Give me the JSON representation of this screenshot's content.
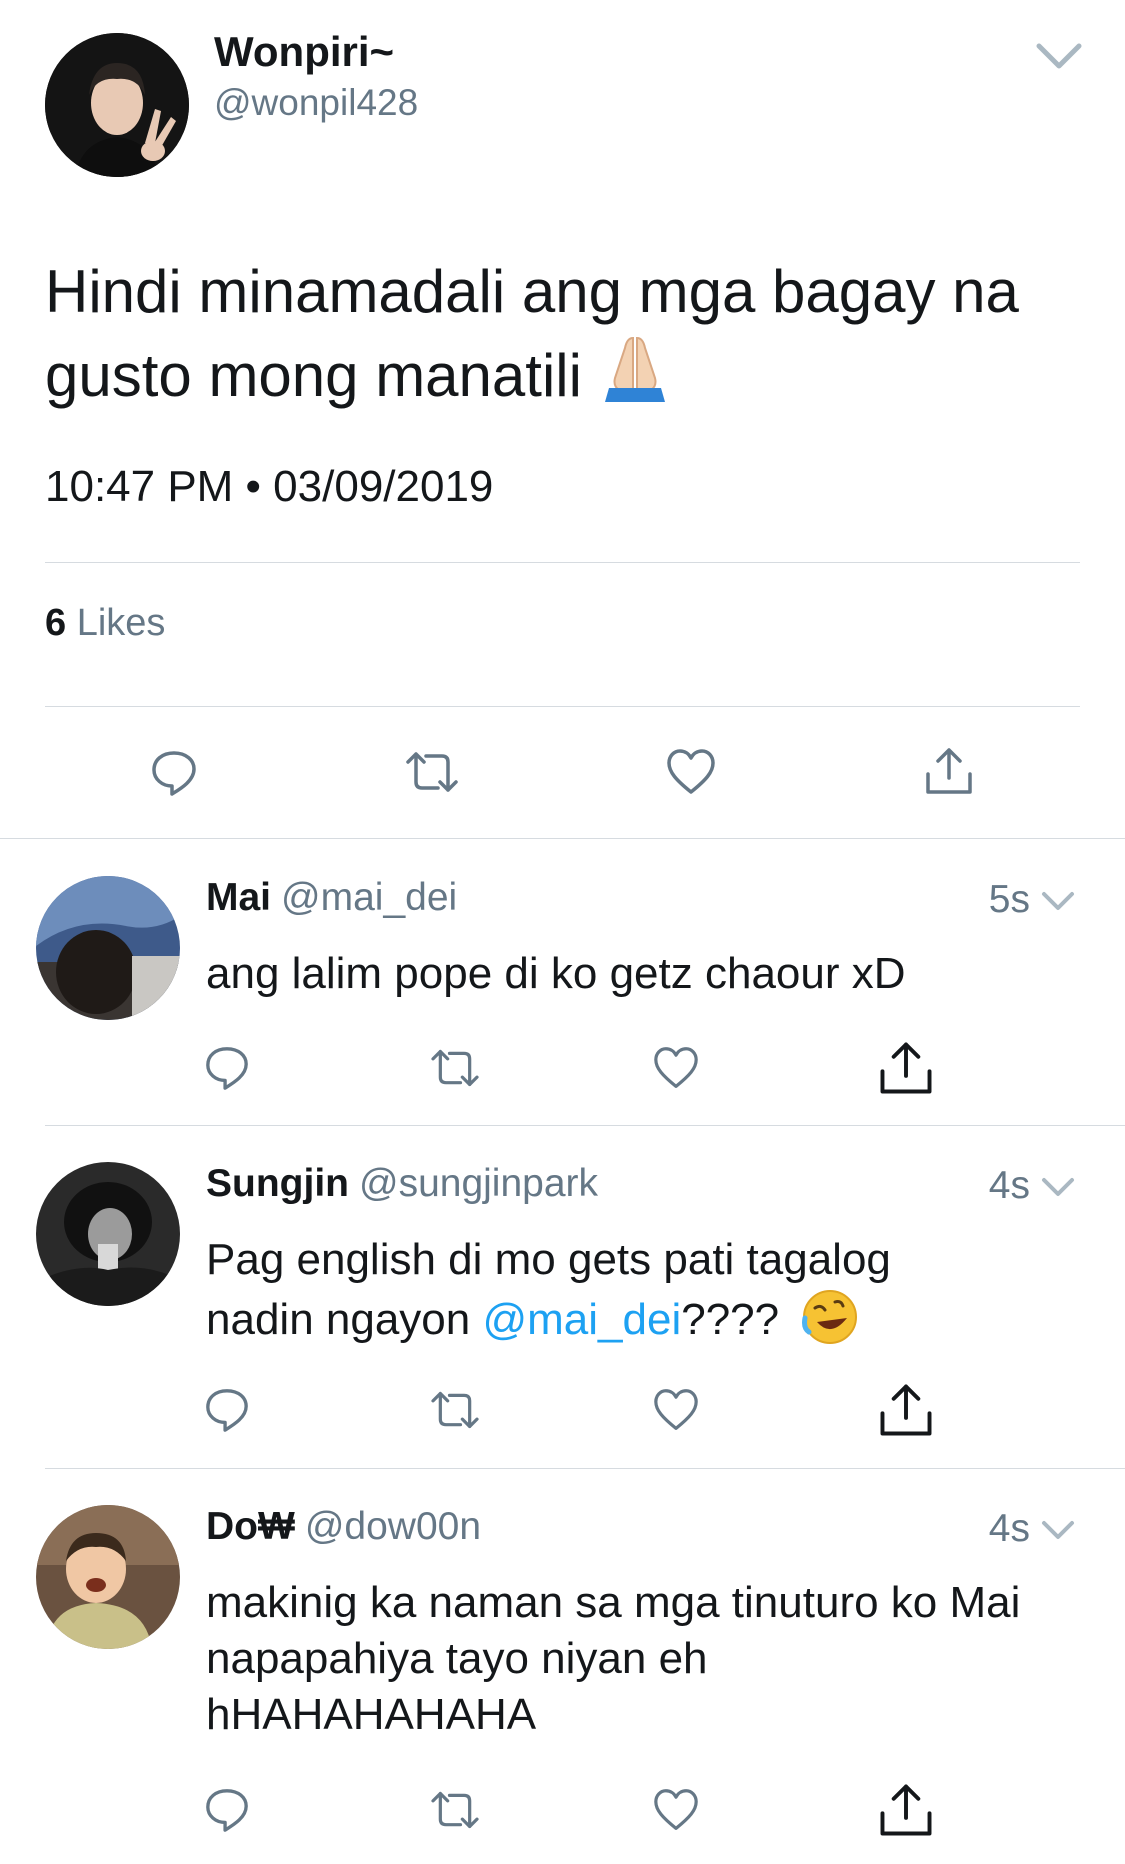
{
  "main_tweet": {
    "display_name": "Wonpiri~",
    "handle": "@wonpil428",
    "text": "Hindi minamadali ang mga bagay na gusto mong manatili",
    "emoji": "folded-hands",
    "timestamp": "10:47 PM • 03/09/2019",
    "likes_count": "6",
    "likes_label": "Likes"
  },
  "replies": [
    {
      "display_name": "Mai",
      "handle": "@mai_dei",
      "time": "5s",
      "text": "ang lalim pope di ko getz chaour xD"
    },
    {
      "display_name": "Sungjin",
      "handle": "@sungjinpark",
      "time": "4s",
      "text_before": "Pag english di mo gets pati tagalog nadin ngayon ",
      "mention": "@mai_dei",
      "text_after": "????",
      "emoji": "rolling-on-floor-laughing"
    },
    {
      "display_name": "Do₩",
      "handle": "@dow00n",
      "time": "4s",
      "text": "makinig ka naman sa mga tinuturo ko Mai napapahiya tayo niyan eh hHAHAHAHAHA"
    }
  ],
  "colors": {
    "text": "#14171a",
    "muted": "#657786",
    "link": "#1da1f2",
    "divider": "#d6dbe0"
  },
  "icons": [
    "reply-icon",
    "retweet-icon",
    "like-icon",
    "share-icon",
    "chevron-down-icon"
  ]
}
